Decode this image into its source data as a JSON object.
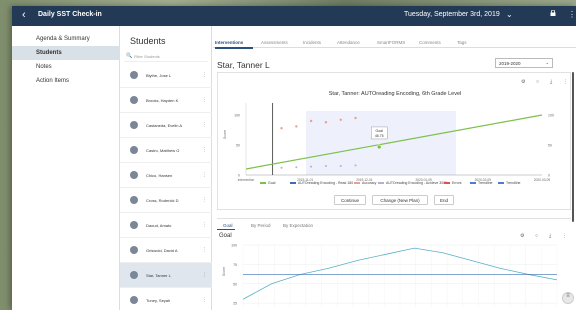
{
  "app": {
    "back_glyph": "‹",
    "title": "Daily SST Check-in",
    "date": "Tuesday, September 3rd, 2019",
    "chevron_glyph": "⌄",
    "kebab_glyph": "⋮"
  },
  "nav": {
    "items": [
      {
        "label": "Agenda & Summary",
        "active": false
      },
      {
        "label": "Students",
        "active": true
      },
      {
        "label": "Notes",
        "active": false
      },
      {
        "label": "Action Items",
        "active": false
      }
    ]
  },
  "students": {
    "heading": "Students",
    "filter_placeholder": "Filter Students",
    "search_glyph": "🔍",
    "kebab_glyph": "⋮",
    "list": [
      "Blythe, Jose L",
      "Brooks, Hayden K",
      "Castaneda, Evelin A",
      "Castro, Matthew G",
      "Chico, Hansen",
      "Cross, Roderick D",
      "Daoud, Amato",
      "Griswold, David A",
      "Star, Tanner L",
      "Tuney, Seyah"
    ],
    "active_index": 8
  },
  "main": {
    "tabs": [
      "Interventions",
      "Assessments",
      "Incidents",
      "Attendance",
      "SmartFORMS",
      "Comments",
      "Tags"
    ],
    "student_name": "Star, Tanner L",
    "school_year": "2019-2020",
    "year_chevron": "⌄",
    "icons": [
      "⚙",
      "○",
      "⤓",
      "⋮"
    ],
    "buttons": {
      "continue": "Continue",
      "change": "Change (New Plan)",
      "end": "End"
    },
    "bottom_tabs": [
      "Goal",
      "By Period",
      "By Expectation"
    ],
    "goal_title": "Goal",
    "fab_glyph": "≡"
  },
  "chart_data": [
    {
      "type": "line",
      "title": "Star, Tanner: AUTOreading Encoding, 6th Grade Level",
      "xlabel": "",
      "ylabel": "Score",
      "y2label": "",
      "x": [
        "Intervention",
        "2019-11-01",
        "2019-12-01",
        "2020-01-09",
        "2020-02-09",
        "2020-03-09"
      ],
      "ylim": [
        0,
        120
      ],
      "y2lim": [
        0,
        120
      ],
      "annotations": [
        {
          "label": "Goal",
          "value": "46.75"
        }
      ],
      "series": [
        {
          "name": "Goal",
          "color": "#7cc04a",
          "values": [
            10,
            100
          ]
        },
        {
          "name": "AUTOreading Encoding - Read 180",
          "color": "#3a6fb4",
          "values": []
        },
        {
          "name": "Accuracy",
          "color": "#e8a090",
          "values": [
            78,
            81,
            90,
            88,
            92,
            95
          ]
        },
        {
          "name": "AUTOreading Encoding - Achieve 3000",
          "color": "#b0b0d8",
          "values": [
            12,
            13,
            14,
            15,
            15,
            16
          ]
        },
        {
          "name": "Errors",
          "color": "#e05050",
          "values": []
        },
        {
          "name": "Trendline",
          "color": "#4a7ed0",
          "values": []
        },
        {
          "name": "Trendline",
          "color": "#4a7ed0",
          "values": []
        }
      ],
      "legend_position": "bottom"
    },
    {
      "type": "line",
      "title": "Goal",
      "ylabel": "Score",
      "ylim": [
        20,
        100
      ],
      "y_ticks": [
        100,
        75,
        50,
        25
      ],
      "series": [
        {
          "name": "",
          "color": "#5ab0c8",
          "values": [
            30,
            50,
            62,
            70,
            80,
            88,
            96,
            90,
            80,
            70,
            62,
            55
          ]
        },
        {
          "name": "",
          "color": "#3a6fb4",
          "values": [
            62,
            62,
            62,
            62,
            62,
            62,
            62,
            62,
            62,
            62,
            62,
            62
          ]
        }
      ]
    }
  ]
}
